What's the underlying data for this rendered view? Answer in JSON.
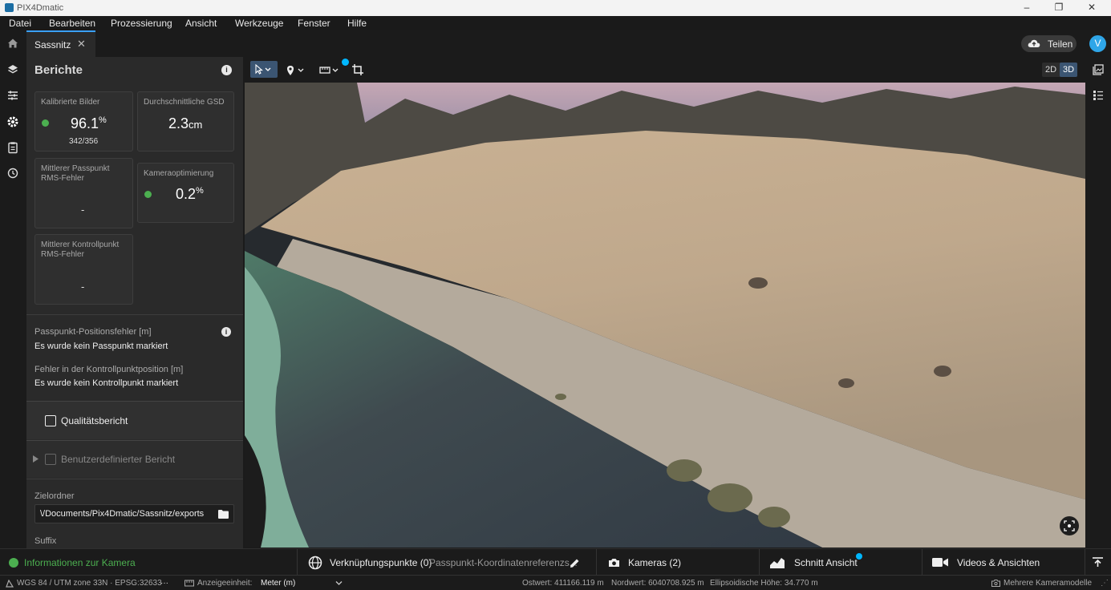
{
  "window": {
    "title": "PIX4Dmatic"
  },
  "menu": [
    "Datei",
    "Bearbeiten",
    "Prozessierung",
    "Ansicht",
    "Werkzeuge",
    "Fenster",
    "Hilfe"
  ],
  "tab": {
    "label": "Sassnitz"
  },
  "share": {
    "label": "Teilen"
  },
  "avatar": {
    "initial": "V"
  },
  "reports": {
    "title": "Berichte",
    "calibrated": {
      "label": "Kalibrierte Bilder",
      "value": "96.1",
      "unit": "%",
      "sub": "342/356"
    },
    "gsd": {
      "label": "Durchschnittliche GSD",
      "value": "2.3",
      "unit": "cm"
    },
    "gcp_rms": {
      "label": "Mittlerer Passpunkt RMS-Fehler",
      "value": "-"
    },
    "cam_opt": {
      "label": "Kameraoptimierung",
      "value": "0.2",
      "unit": "%"
    },
    "ckp_rms": {
      "label": "Mittlerer Kontrollpunkt RMS-Fehler",
      "value": "-"
    },
    "gcp_pos": {
      "label": "Passpunkt-Positionsfehler [m]",
      "value": "Es wurde kein Passpunkt markiert"
    },
    "ckp_pos": {
      "label": "Fehler in der Kontrollpunktposition [m]",
      "value": "Es wurde kein Kontrollpunkt markiert"
    },
    "quality_report": "Qualitätsbericht",
    "custom_report": "Benutzerdefinierter Bericht",
    "folder_label": "Zielordner",
    "folder_value": "\\/Documents/Pix4Dmatic/Sassnitz/exports",
    "suffix_label": "Suffix"
  },
  "view": {
    "mode_2d": "2D",
    "mode_3d": "3D"
  },
  "bottom": {
    "camera_info": "Informationen zur Kamera",
    "tiepoints": "Verknüpfungspunkte (0)",
    "gcp_ref": "Passpunkt-Koordinatenreferenzs...",
    "cameras": "Kameras (2)",
    "section": "Schnitt Ansicht",
    "videos": "Videos & Ansichten"
  },
  "status": {
    "crs": "WGS 84 / UTM zone 33N · EPSG:32633",
    "more": "···",
    "unit_label": "Anzeigeeinheit:",
    "unit_value": "Meter (m)",
    "east": "Ostwert: 411166.119 m",
    "north": "Nordwert: 6040708.925 m",
    "height": "Ellipsoidische Höhe: 34.770 m",
    "cam_models": "Mehrere Kameramodelle"
  },
  "colors": {
    "accent": "#3aa0ff",
    "ok": "#4caf50",
    "panel": "#2a2a2a"
  }
}
